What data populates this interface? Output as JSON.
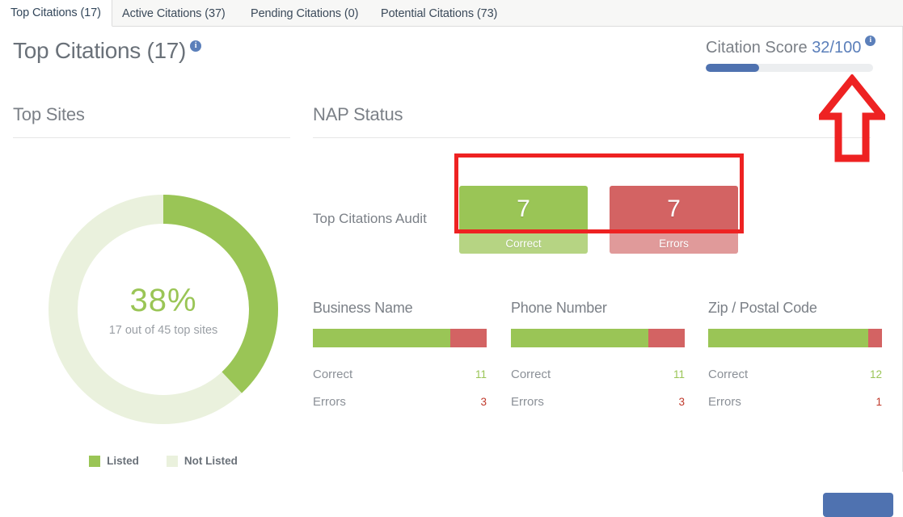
{
  "tabs": [
    {
      "label": "Top Citations (17)",
      "active": true
    },
    {
      "label": "Active Citations (37)",
      "active": false
    },
    {
      "label": "Pending Citations (0)",
      "active": false
    },
    {
      "label": "Potential Citations (73)",
      "active": false
    }
  ],
  "header": {
    "page_title": "Top Citations (17)",
    "info_glyph": "i",
    "score_label": "Citation Score",
    "score_value": "32/100",
    "score_percent": 32
  },
  "top_sites": {
    "heading": "Top Sites",
    "percent_label": "38%",
    "subtitle": "17 out of 45 top sites",
    "legend": [
      {
        "label": "Listed",
        "color": "#9ac556"
      },
      {
        "label": "Not Listed",
        "color": "#eaf1dd"
      }
    ]
  },
  "nap_status": {
    "heading": "NAP Status",
    "audit_label": "Top Citations Audit",
    "audit_tiles": [
      {
        "value": "7",
        "caption": "Correct",
        "color": "#9ac556",
        "footer_color": "#b6d483"
      },
      {
        "value": "7",
        "caption": "Errors",
        "color": "#d36363",
        "footer_color": "#e09a9a"
      }
    ],
    "metrics": [
      {
        "title": "Business Name",
        "correct_label": "Correct",
        "correct_value": "11",
        "errors_label": "Errors",
        "errors_value": "3",
        "correct_percent": 79
      },
      {
        "title": "Phone Number",
        "correct_label": "Correct",
        "correct_value": "11",
        "errors_label": "Errors",
        "errors_value": "3",
        "correct_percent": 79
      },
      {
        "title": "Zip / Postal Code",
        "correct_label": "Correct",
        "correct_value": "12",
        "errors_label": "Errors",
        "errors_value": "1",
        "correct_percent": 92
      }
    ]
  },
  "colors": {
    "green": "#9ac556",
    "pale_green": "#eaf1dd",
    "red": "#d36363",
    "blue": "#4f72b0",
    "annotation_red": "#ee2222"
  },
  "chart_data": {
    "type": "pie",
    "title": "Top Sites",
    "categories": [
      "Listed",
      "Not Listed"
    ],
    "values": [
      17,
      28
    ],
    "percentages": [
      38,
      62
    ],
    "total": 45,
    "center_label": "38%",
    "center_sublabel": "17 out of 45 top sites",
    "colors": [
      "#9ac556",
      "#eaf1dd"
    ],
    "legend_position": "bottom",
    "donut": true
  }
}
